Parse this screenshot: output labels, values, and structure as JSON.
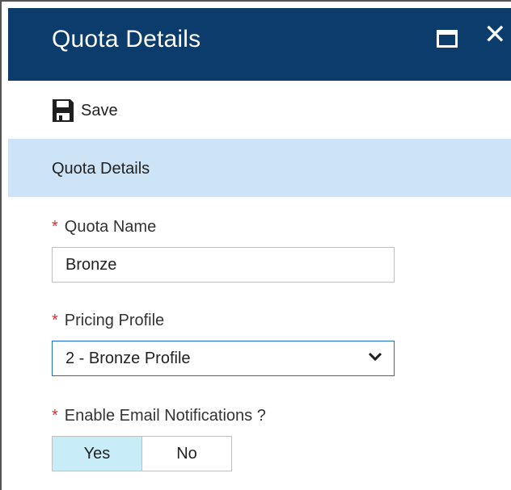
{
  "blade": {
    "title": "Quota Details",
    "maximize_icon": "maximize-icon",
    "close_glyph": "✕"
  },
  "toolbar": {
    "save_label": "Save",
    "save_icon": "floppy-disk-icon"
  },
  "section": {
    "title": "Quota Details"
  },
  "form": {
    "required_marker": "*",
    "quota_name": {
      "label": "Quota Name",
      "value": "Bronze"
    },
    "pricing_profile": {
      "label": "Pricing Profile",
      "selected": "2 - Bronze Profile"
    },
    "email_notifications": {
      "label": "Enable Email Notifications ?",
      "options": [
        "Yes",
        "No"
      ],
      "selected": "Yes"
    }
  },
  "colors": {
    "header_bg": "#0b3c6b",
    "section_bg": "#cde4f6",
    "required": "#d13438",
    "toggle_selected": "#c8ecf8",
    "select_border": "#1c6fc2"
  }
}
